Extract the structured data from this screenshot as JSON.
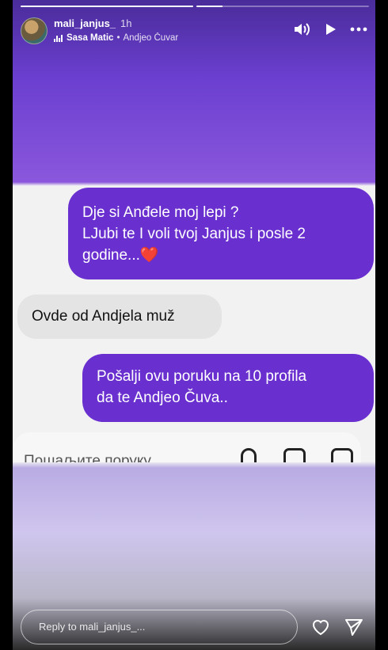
{
  "story": {
    "progress": [
      1,
      0.15
    ],
    "username": "mali_janjus_",
    "time": "1h",
    "music": {
      "artist": "Sasa Matic",
      "separator": "•",
      "song": "Andjeo Čuvar"
    },
    "header_icons": [
      "volume-icon",
      "play-icon",
      "more-icon"
    ]
  },
  "chat": {
    "messages": [
      {
        "direction": "out",
        "lines": [
          "Dje si Anđele moj lepi ?",
          "LJubi te I voli tvoj Janjus i posle 2",
          "godine..."
        ],
        "emoji": "❤️"
      },
      {
        "direction": "in",
        "lines": [
          "Ovde od Andjela muž"
        ]
      },
      {
        "direction": "out",
        "lines": [
          "Pošalji ovu poruku na 10 profila",
          "da te Andjeo Čuva.."
        ]
      }
    ],
    "input_placeholder": "Пошаљите поруку..."
  },
  "footer": {
    "reply_placeholder": "Reply to mali_janjus_...",
    "icons": [
      "heart-icon",
      "send-icon"
    ]
  }
}
